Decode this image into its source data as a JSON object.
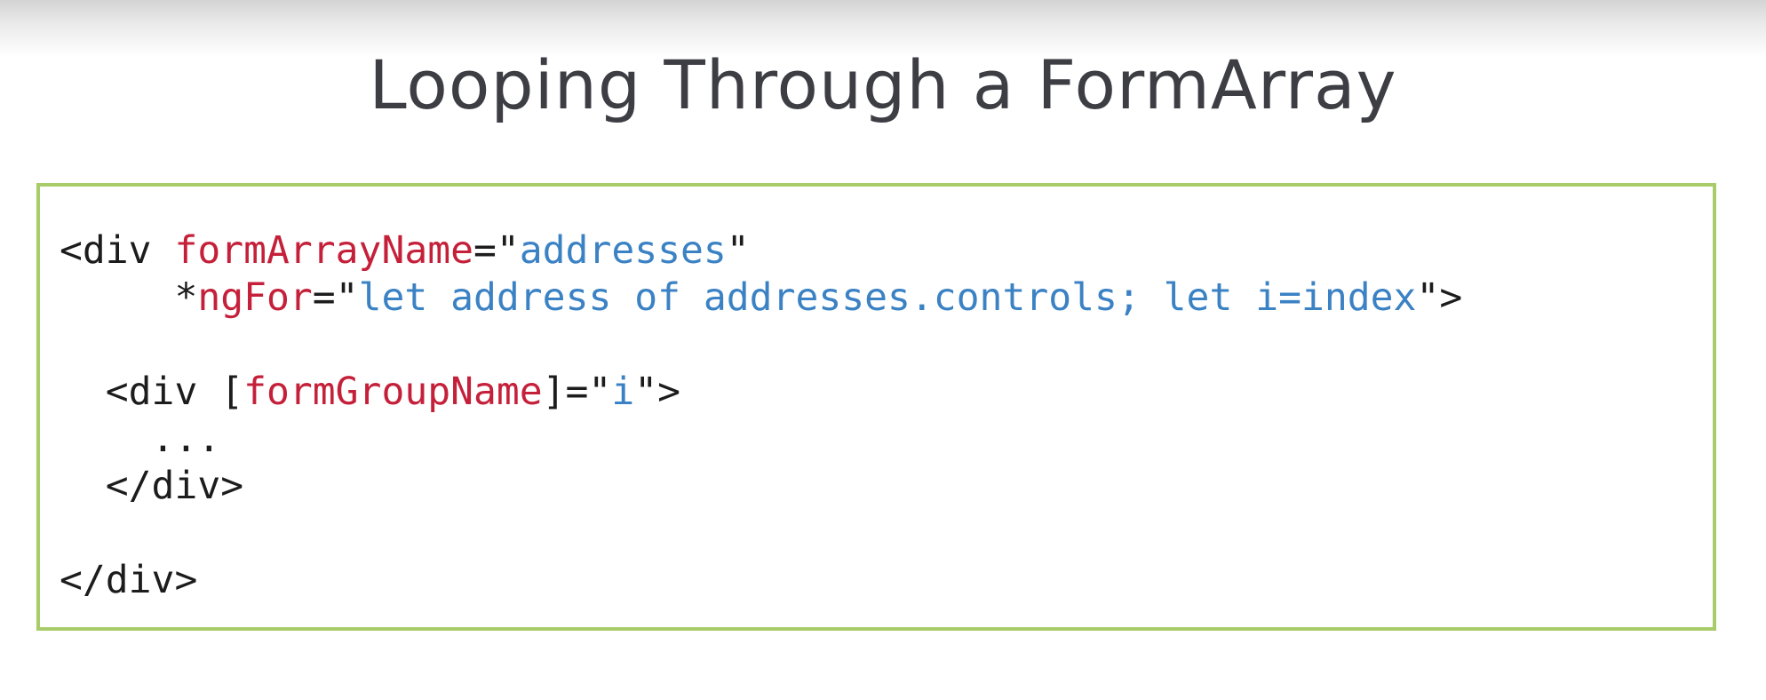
{
  "slide": {
    "title": "Looping Through a FormArray"
  },
  "code": {
    "line1": {
      "open": "<div ",
      "attr": "formArrayName",
      "eq": "=\"",
      "value": "addresses",
      "close": "\""
    },
    "line2": {
      "indent": "     *",
      "attr": "ngFor",
      "eq": "=\"",
      "value": "let address of addresses.controls; let i=index",
      "close": "\">"
    },
    "line3": {
      "open": "  <div [",
      "attr": "formGroupName",
      "eq": "]=\"",
      "value": "i",
      "close": "\">"
    },
    "line4": "    ...",
    "line5": "  </div>",
    "line6": "</div>"
  },
  "colors": {
    "attribute": "#c5203a",
    "string": "#3b82c4",
    "text": "#1c1c1c",
    "box_border": "#a8cc6a",
    "title": "#3d3d44"
  }
}
